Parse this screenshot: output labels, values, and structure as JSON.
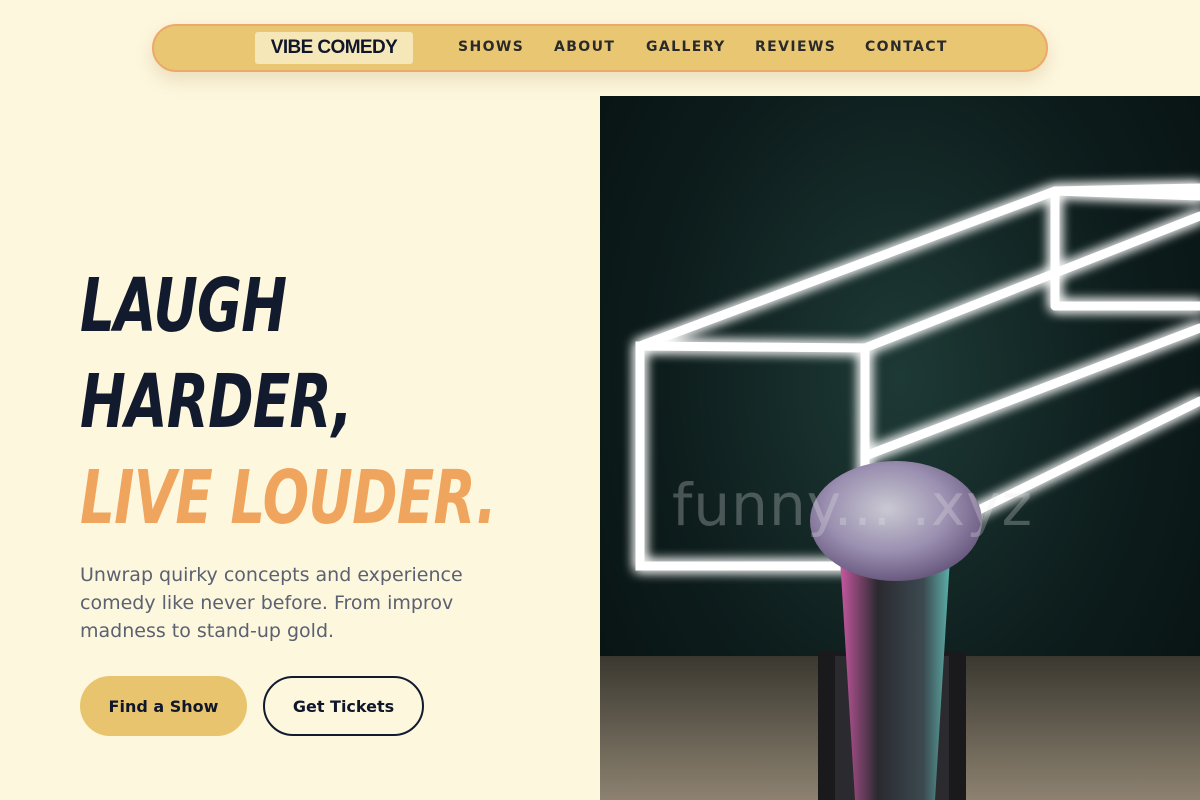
{
  "nav": {
    "brand": "VIBE COMEDY",
    "links": [
      "SHOWS",
      "ABOUT",
      "GALLERY",
      "REVIEWS",
      "CONTACT"
    ]
  },
  "hero": {
    "headline_line1": "LAUGH",
    "headline_line2": "HARDER,",
    "headline_accent": "LIVE LOUDER.",
    "subtext": "Unwrap quirky concepts and experience comedy like never before. From improv madness to stand-up gold.",
    "primary_button": "Find a Show",
    "secondary_button": "Get Tickets",
    "image_watermark": "funny... .xyz"
  },
  "colors": {
    "background": "#fdf7de",
    "nav_fill": "#e9c772",
    "nav_border": "#eda86a",
    "accent_orange": "#f0a55e",
    "primary_button": "#e7c46d",
    "dark_text": "#121a2d"
  },
  "icons": {
    "hero_image": "microphone-neon-stage-photo"
  }
}
